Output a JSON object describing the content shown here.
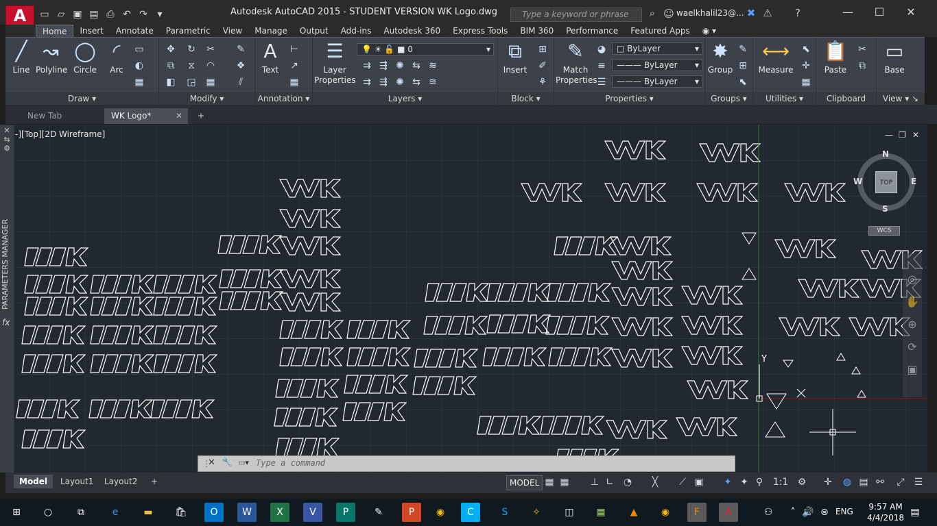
{
  "window": {
    "app_letter": "A",
    "title": "Autodesk AutoCAD 2015 - STUDENT VERSION     WK Logo.dwg",
    "search_placeholder": "Type a keyword or phrase",
    "user": "waelkhalil23@...",
    "help": "?",
    "minimize": "—",
    "maximize": "☐",
    "close": "✕"
  },
  "ribbon_tabs": [
    "Home",
    "Insert",
    "Annotate",
    "Parametric",
    "View",
    "Manage",
    "Output",
    "Add-ins",
    "Autodesk 360",
    "Express Tools",
    "BIM 360",
    "Performance",
    "Featured Apps"
  ],
  "active_tab": "Home",
  "panels": {
    "draw": {
      "title": "Draw",
      "tools": [
        "Line",
        "Polyline",
        "Circle",
        "Arc"
      ]
    },
    "modify": {
      "title": "Modify"
    },
    "annotation": {
      "title": "Annotation",
      "tools": [
        "Text"
      ]
    },
    "layers": {
      "title": "Layers",
      "tool": "Layer\nProperties",
      "tool_l1": "Layer",
      "tool_l2": "Properties",
      "current_layer": "0"
    },
    "block": {
      "title": "Block",
      "tool": "Insert"
    },
    "properties": {
      "title": "Properties",
      "tool_l1": "Match",
      "tool_l2": "Properties",
      "color": "ByLayer",
      "linetype": "ByLayer",
      "lineweight": "ByLayer"
    },
    "groups": {
      "title": "Groups",
      "tool": "Group"
    },
    "utilities": {
      "title": "Utilities",
      "tool": "Measure"
    },
    "clipboard": {
      "title": "Clipboard",
      "tool": "Paste"
    },
    "view": {
      "title": "View",
      "tool": "Base"
    }
  },
  "file_tabs": [
    "New Tab",
    "WK Logo*"
  ],
  "viewport_label": "-][Top][2D Wireframe]",
  "side_panel_label": "PARAMETERS MANAGER",
  "viewcube": {
    "n": "N",
    "s": "S",
    "e": "E",
    "w": "W",
    "face": "TOP",
    "ucs": "WCS"
  },
  "command_placeholder": "Type a command",
  "layout_tabs": [
    "Model",
    "Layout1",
    "Layout2"
  ],
  "status": {
    "model": "MODEL",
    "scale": "1:1"
  },
  "ucs_axis": "Y",
  "taskbar": {
    "time": "9:57 AM",
    "date": "4/4/2018",
    "lang": "ENG",
    "notif": "1"
  },
  "colors": {
    "accent": "#c8102e",
    "canvas": "#212830",
    "ribbon": "#3d424a",
    "linework": "#ffffff"
  }
}
